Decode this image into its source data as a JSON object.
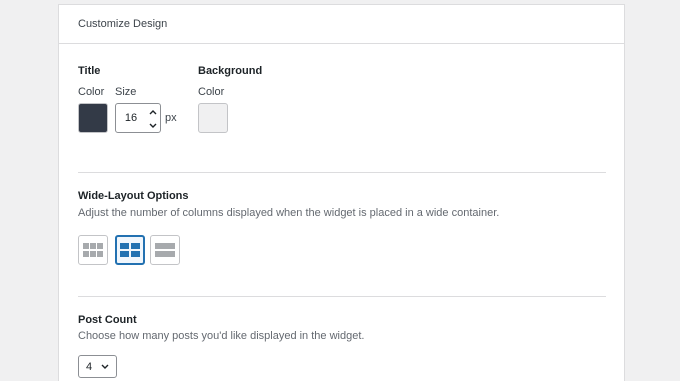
{
  "panel": {
    "title": "Customize Design"
  },
  "title_section": {
    "heading": "Title",
    "color_label": "Color",
    "size_label": "Size",
    "color_value": "#333a47",
    "size_value": "16",
    "size_unit": "px"
  },
  "background_section": {
    "heading": "Background",
    "color_label": "Color",
    "color_value": "#f0f0f1"
  },
  "wide_layout": {
    "heading": "Wide-Layout Options",
    "description": "Adjust the number of columns displayed when the widget is placed in a wide container.",
    "options": [
      {
        "icon": "three-column-grid-icon",
        "selected": false
      },
      {
        "icon": "two-column-grid-icon",
        "selected": true
      },
      {
        "icon": "one-column-rows-icon",
        "selected": false
      }
    ]
  },
  "post_count": {
    "heading": "Post Count",
    "description": "Choose how many posts you'd like displayed in the widget.",
    "value": "4"
  },
  "colors": {
    "accent": "#2271b1",
    "icon_gray": "#a7aaad",
    "icon_blue": "#2271b1"
  }
}
